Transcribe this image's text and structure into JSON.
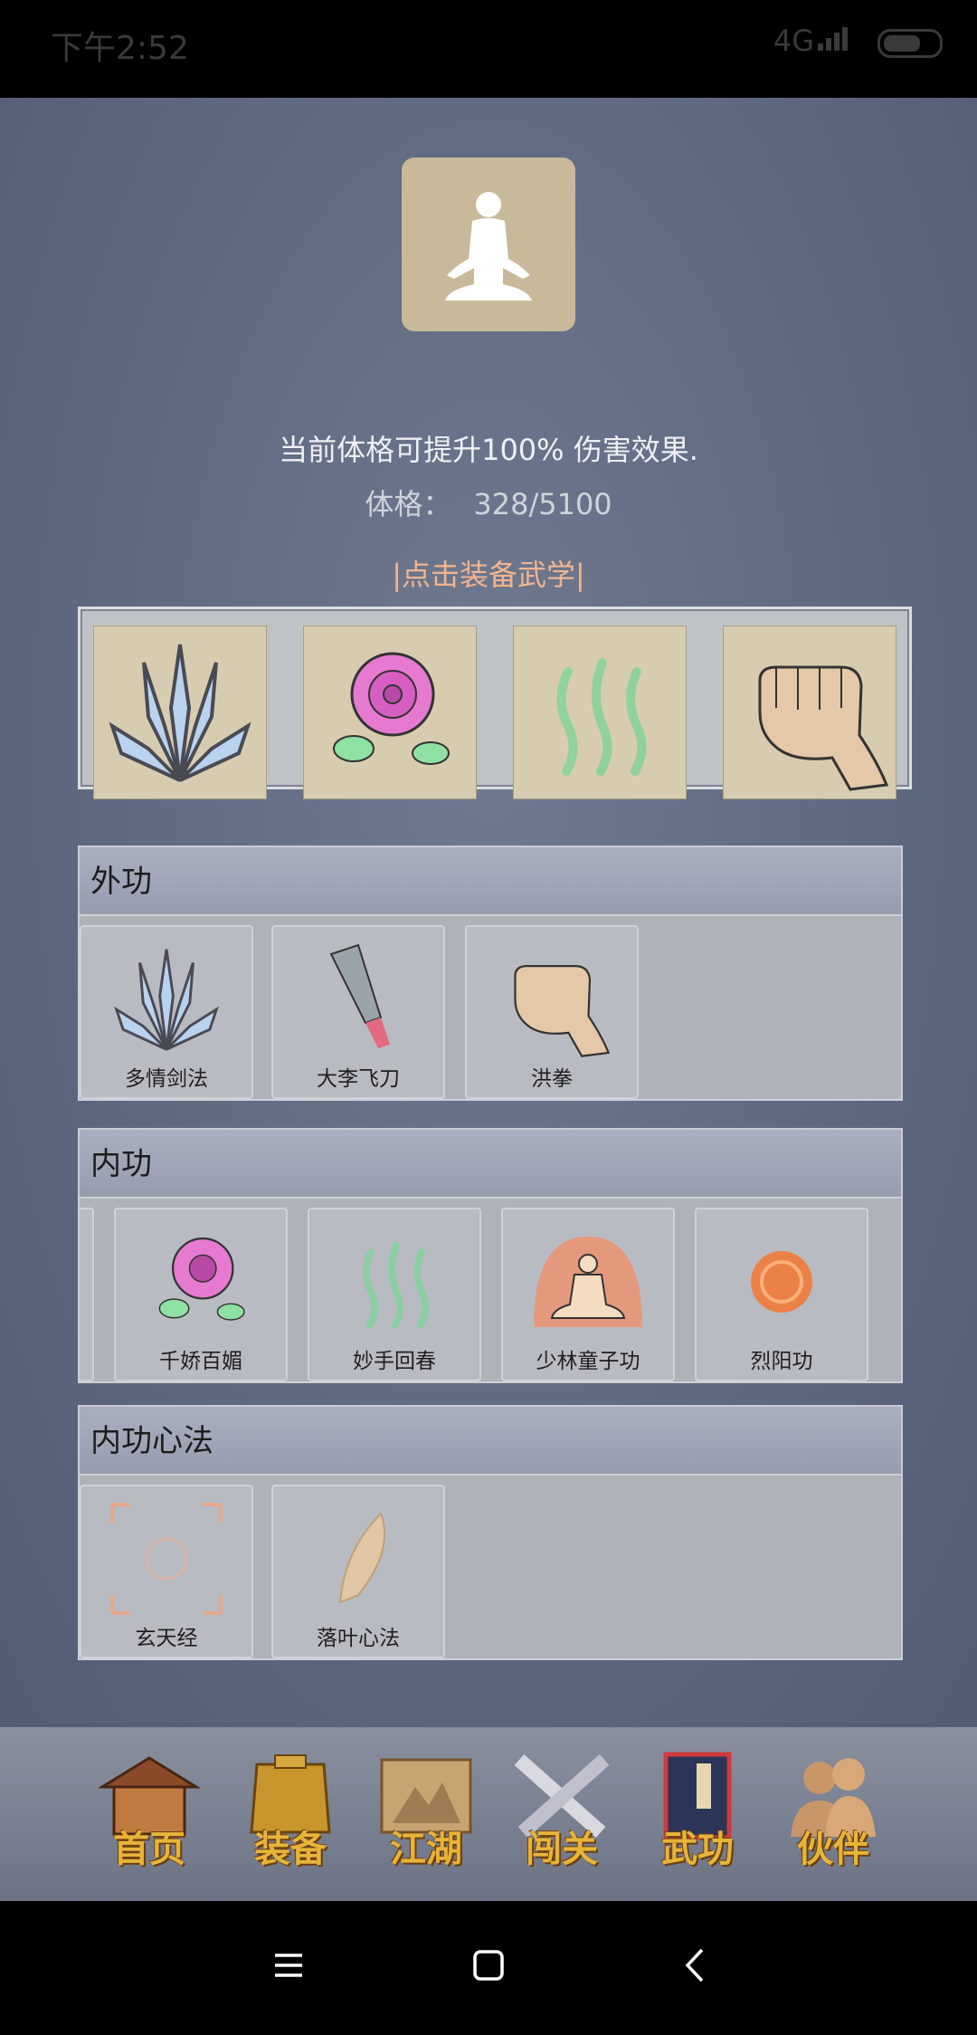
{
  "status_bar": {
    "time": "下午2:52",
    "network": "4G"
  },
  "profile": {
    "avatar_icon": "meditating-figure-icon"
  },
  "info": {
    "damage_text": "当前体格可提升100% 伤害效果.",
    "constitution_label": "体格：",
    "constitution_value": "328/5100",
    "equip_link": "|点击装备武学|"
  },
  "equipped_slots": [
    {
      "icon": "sword-fan-icon"
    },
    {
      "icon": "rose-icon"
    },
    {
      "icon": "green-qi-icon"
    },
    {
      "icon": "fist-icon"
    }
  ],
  "sections": {
    "external": {
      "title": "外功",
      "skills": [
        {
          "name": "多情剑法",
          "icon": "sword-fan-icon"
        },
        {
          "name": "大李飞刀",
          "icon": "flying-knife-icon"
        },
        {
          "name": "洪拳",
          "icon": "fist-icon"
        }
      ]
    },
    "internal": {
      "title": "内功",
      "skills": [
        {
          "name": "千娇百媚",
          "icon": "rose-icon"
        },
        {
          "name": "妙手回春",
          "icon": "green-qi-icon"
        },
        {
          "name": "少林童子功",
          "icon": "meditating-monk-icon"
        },
        {
          "name": "烈阳功",
          "icon": "sun-orb-icon"
        }
      ]
    },
    "mind": {
      "title": "内功心法",
      "skills": [
        {
          "name": "玄天经",
          "icon": "xuan-scroll-icon"
        },
        {
          "name": "落叶心法",
          "icon": "leaf-icon"
        }
      ]
    }
  },
  "nav": [
    {
      "label": "首页",
      "icon": "house-icon"
    },
    {
      "label": "装备",
      "icon": "armor-icon"
    },
    {
      "label": "江湖",
      "icon": "scroll-map-icon"
    },
    {
      "label": "闯关",
      "icon": "crossed-swords-icon"
    },
    {
      "label": "武功",
      "icon": "book-icon"
    },
    {
      "label": "伙伴",
      "icon": "companions-icon"
    }
  ]
}
